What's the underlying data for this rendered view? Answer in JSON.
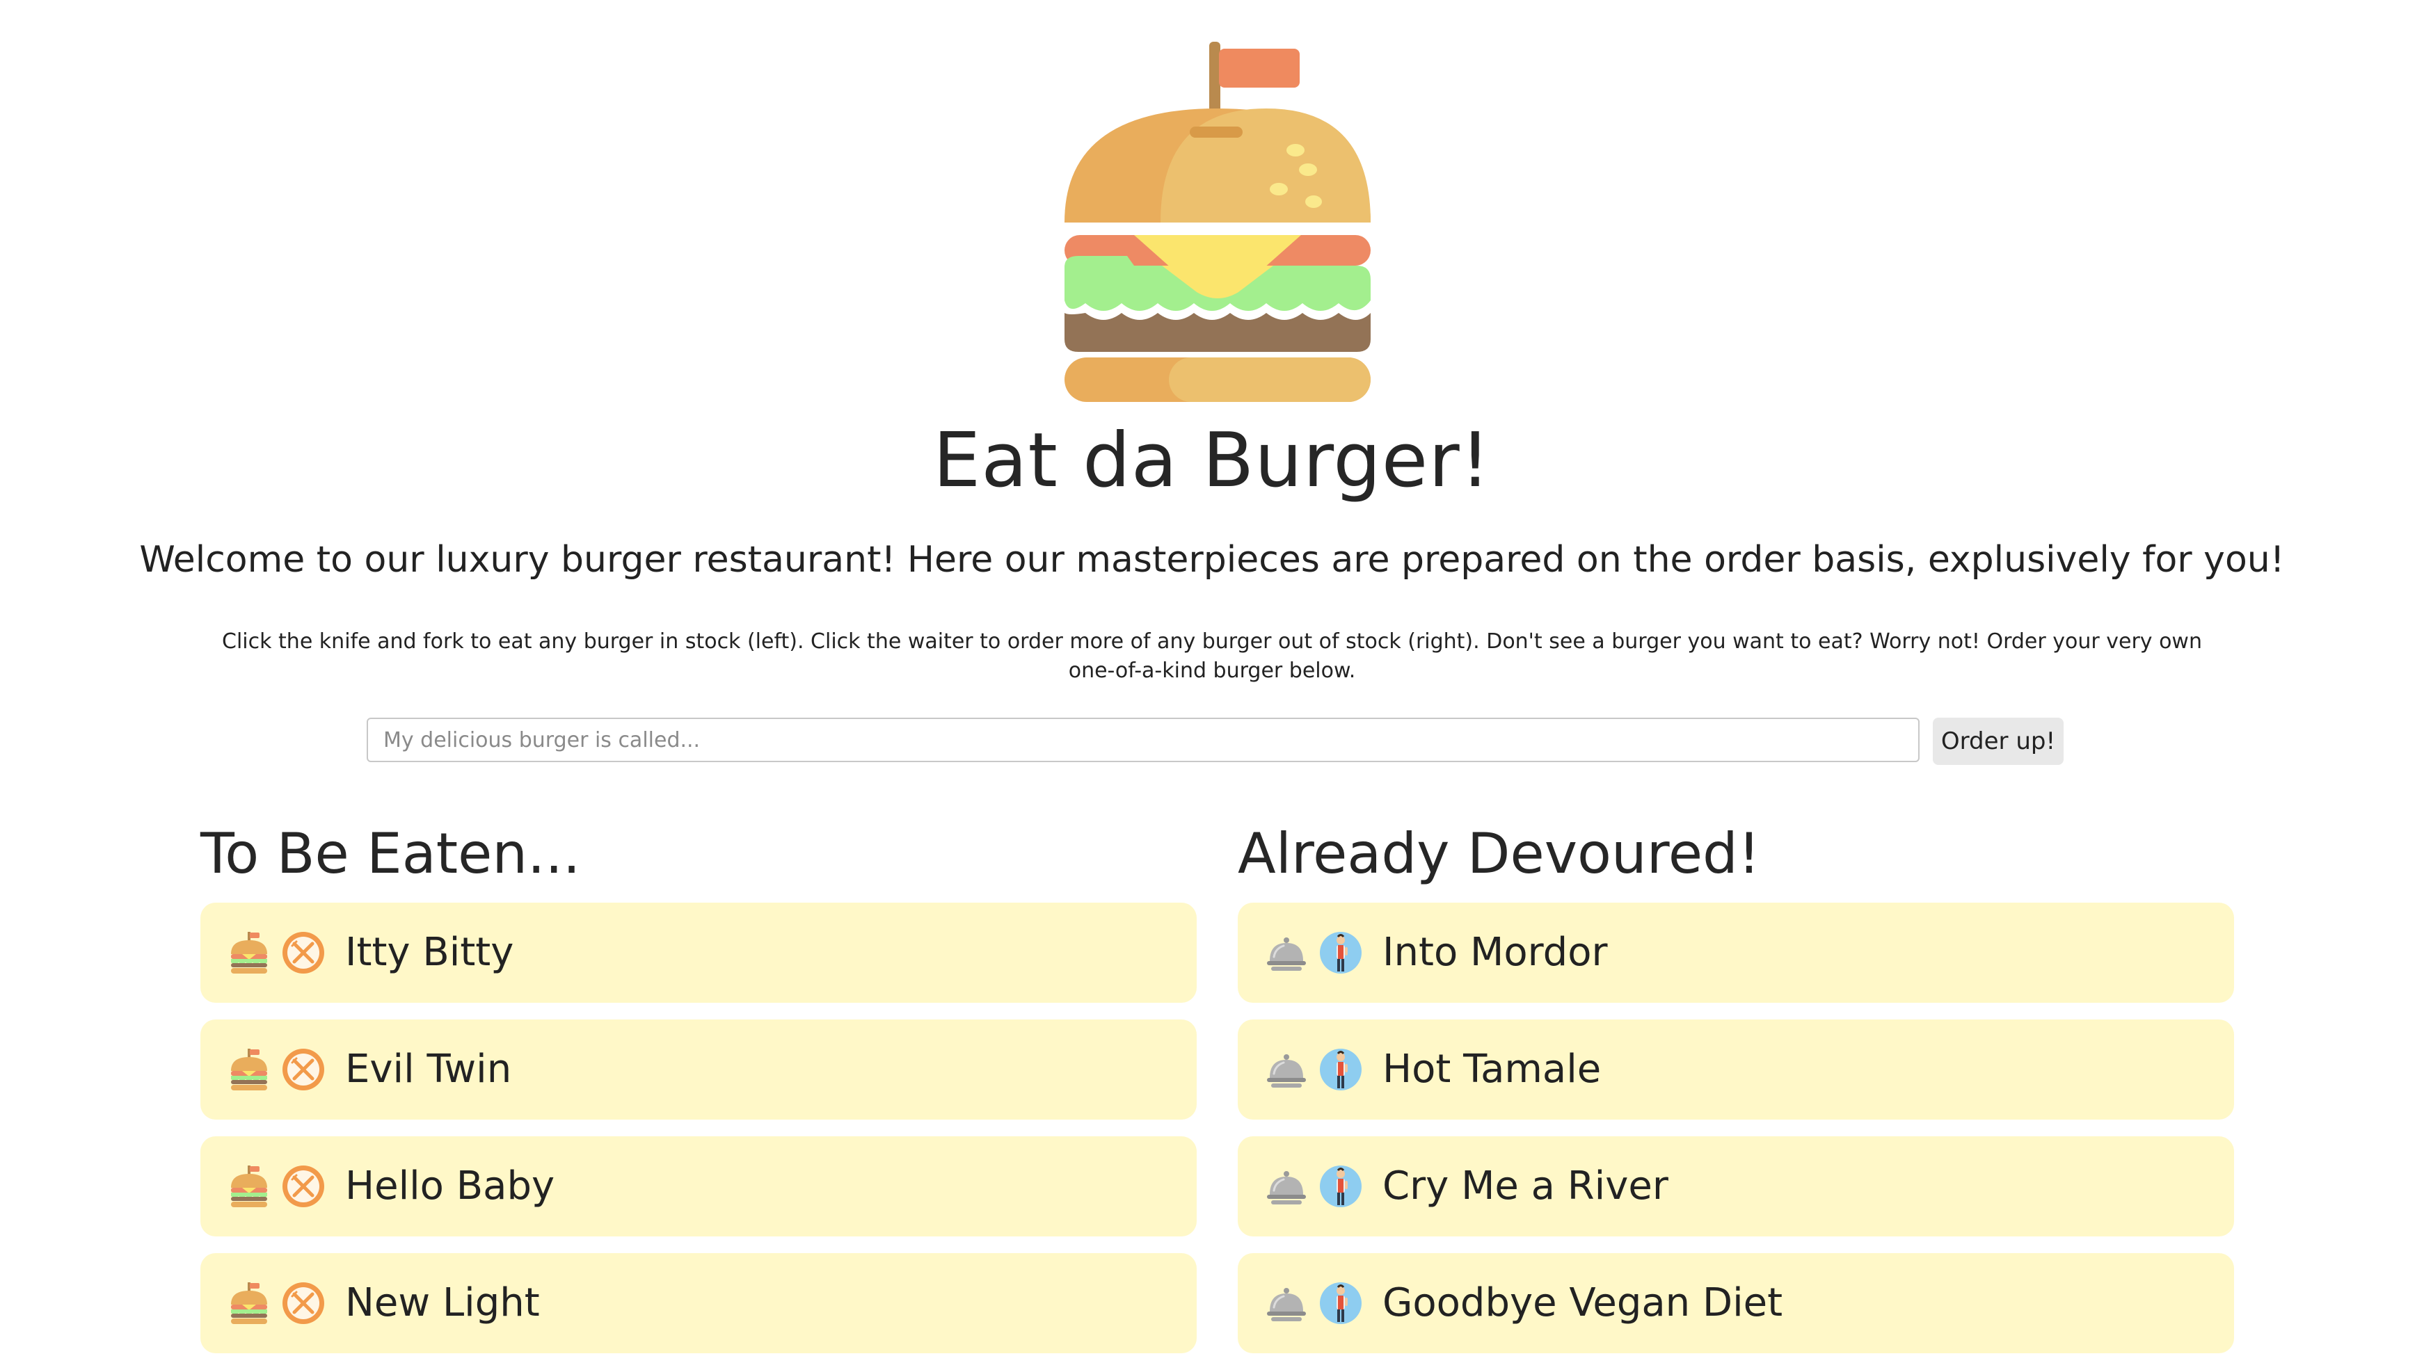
{
  "header": {
    "title": "Eat da Burger!",
    "subtitle": "Welcome to our luxury burger restaurant! Here our masterpieces are prepared on the order basis, explusively for you!",
    "instructions": "Click the knife and fork to eat any burger in stock (left). Click the waiter to order more of any burger out of stock (right). Don't see a burger you want to eat? Worry not! Order your very own one-of-a-kind burger below."
  },
  "order_form": {
    "placeholder": "My delicious burger is called...",
    "value": "",
    "button_label": "Order up!"
  },
  "to_be_eaten": {
    "heading": "To Be Eaten...",
    "icons": [
      "burger-icon",
      "knife-fork-icon"
    ],
    "items": [
      {
        "name": "Itty Bitty"
      },
      {
        "name": "Evil Twin"
      },
      {
        "name": "Hello Baby"
      },
      {
        "name": "New Light"
      }
    ]
  },
  "devoured": {
    "heading": "Already Devoured!",
    "icons": [
      "cloche-icon",
      "waiter-icon"
    ],
    "items": [
      {
        "name": "Into Mordor"
      },
      {
        "name": "Hot Tamale"
      },
      {
        "name": "Cry Me a River"
      },
      {
        "name": "Goodbye Vegan Diet"
      }
    ]
  },
  "colors": {
    "background": "#ffffff",
    "card_background": "#fff8c8",
    "button_background": "#e8e8e8",
    "bun": "#eab566",
    "lettuce": "#a3ef8e",
    "tomato": "#ee8a64",
    "cheese": "#fbe56d",
    "patty": "#937356"
  }
}
